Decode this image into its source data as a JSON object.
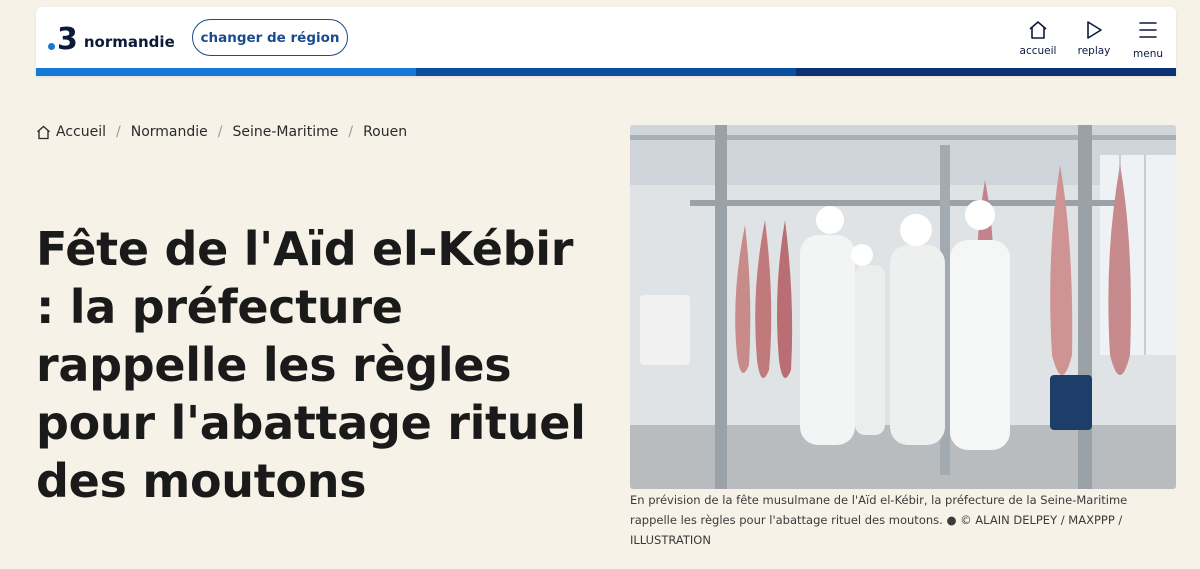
{
  "header": {
    "logo": {
      "number": "3",
      "region": "normandie"
    },
    "change_region_label": "changer de région",
    "nav": {
      "home_label": "accueil",
      "replay_label": "replay",
      "menu_label": "menu"
    },
    "progress_colors": [
      "#1479d8",
      "#0a4ea0",
      "#0a3275"
    ]
  },
  "breadcrumb": [
    "Accueil",
    "Normandie",
    "Seine-Maritime",
    "Rouen"
  ],
  "article": {
    "title": "Fête de l'Aïd el-Kébir : la préfecture rappelle les règles pour l'abattage rituel des moutons",
    "image_caption": "En prévision de la fête musulmane de l'Aïd el-Kébir, la préfecture de la Seine-Maritime rappelle les règles pour l'abattage rituel des moutons. ● © ALAIN DELPEY / MAXPPP / ILLUSTRATION"
  },
  "colors": {
    "background": "#f6f2e8",
    "accent_blue": "#1479d8",
    "dark_navy": "#0c1a3a"
  }
}
